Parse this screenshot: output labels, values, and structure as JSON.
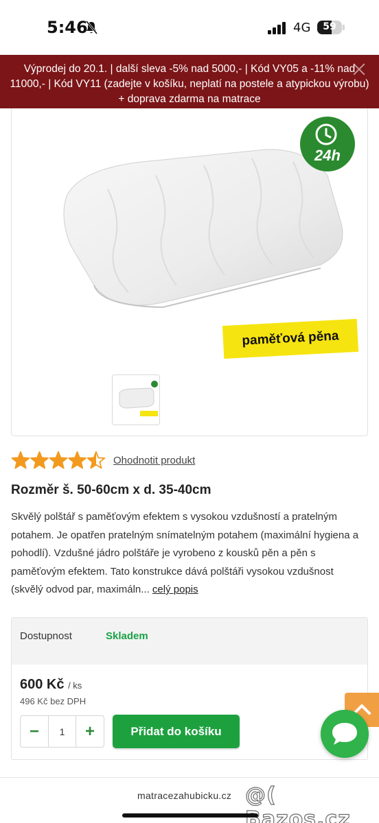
{
  "status_bar": {
    "time": "5:46",
    "network": "4G",
    "battery_level": "59"
  },
  "promo_banner": {
    "text": "Výprodej do 20.1. | další sleva -5% nad 5000,- | Kód VY05 a -11% nad 11000,- | Kód VY11 (zadejte v košíku, neplatí na postele a atypickou výrobu) + doprava zdarma na matrace"
  },
  "gallery": {
    "delivery_badge": "24h",
    "material_label": "paměťová pěna",
    "badge_color": "#2b8a2f",
    "label_color": "#f6e410"
  },
  "rating": {
    "stars": 4.5,
    "max_stars": 5,
    "star_color": "#f29a1f",
    "rate_link": "Ohodnotit produkt"
  },
  "product": {
    "size_title": "Rozměr š. 50-60cm x d. 35-40cm",
    "description": "Skvělý polštář s paměťovým efektem s vysokou vzdušností a pratelným potahem. Je opatřen pratelným snímatelným potahem (maximální hygiena a pohodlí). Vzdušné jádro polštáře je vyrobeno z kousků pěn a pěn s paměťovým efektem. Tato konstrukce dává polštáři vysokou vzdušnost (skvělý odvod par, maximáln...",
    "more_link": "celý popis"
  },
  "buy_box": {
    "availability_label": "Dostupnost",
    "availability_value": "Skladem",
    "availability_color": "#1aa246",
    "price": "600 Kč",
    "price_unit": "/ ks",
    "price_net": "496 Kč bez DPH",
    "quantity": "1",
    "minus_label": "−",
    "plus_label": "+",
    "add_to_cart": "Přidat do košíku",
    "button_color": "#1da13f"
  },
  "footer": {
    "domain": "matracezahubicku.cz",
    "watermark": "@( Bazos.cz"
  }
}
